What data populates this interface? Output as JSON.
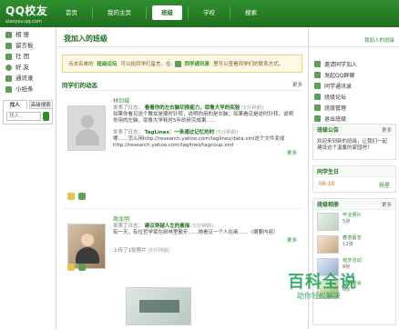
{
  "app": {
    "brand": "QQ校友",
    "domain": "xiaoyou.qq.com"
  },
  "nav": {
    "items": [
      "首页",
      "我的主页",
      "班级",
      "学校",
      "搜索"
    ],
    "active": "班级"
  },
  "left": {
    "items": [
      {
        "label": "相 册",
        "icon": "photo-icon"
      },
      {
        "label": "留言板",
        "icon": "message-board-icon"
      },
      {
        "label": "社 团",
        "icon": "club-icon"
      },
      {
        "label": "好 友",
        "icon": "friends-icon"
      },
      {
        "label": "通讯录",
        "icon": "address-book-icon"
      },
      {
        "label": "小纸条",
        "icon": "note-icon"
      }
    ],
    "search": {
      "tabs": [
        "找人",
        "高级搜索"
      ],
      "placeholder": "找人..."
    }
  },
  "main": {
    "header_title": "我加入的班级",
    "notice": {
      "prefix": "点击名单的",
      "link": "班级论坛",
      "middle": "可以给同学们留言，在",
      "link2": "同学通讯录",
      "suffix": "里可以查看同学们的联系方式。"
    },
    "feed_title": "同学们的动态",
    "feed_more": "更多",
    "feed": [
      {
        "user": "林剑城",
        "posts": [
          {
            "meta": "发表了日志：",
            "title": "看看你的左右脑切换能力，耶鲁大学的实验",
            "time": "(5分钟前)",
            "text": "如果你看见这个舞女是顺时针转，说明你用的是右脑；如果看见是逆时针转，说明你用的左脑，耶鲁大学耗时5年的研究成果……"
          },
          {
            "meta": "发表了日志：",
            "title": "TagLines：一条通过记忆的时",
            "time": "(5分钟前)",
            "text": "哪……怎么用http://research.yahoo.com/taglines/data.xml这个文件变成http://research.yahoo.com/taglines/tagcoup.xml"
          }
        ],
        "more": "更多"
      },
      {
        "user": "周龙明",
        "posts": [
          {
            "meta": "发表了日志：",
            "title": "建议穿越人生的素描",
            "time": "(5分钟前)",
            "text": "有一天，有位哲学家在树林里散步……她看见一个人在画……（摘要内容）"
          },
          {
            "meta": "上传了1张照片",
            "title": "",
            "time": "(5分钟前)",
            "text": ""
          }
        ],
        "more": "更多"
      }
    ]
  },
  "right": {
    "top_link": "我加入的班级",
    "actions": [
      {
        "label": "邀请同学加入",
        "icon": "invite-icon"
      },
      {
        "label": "发起QQ群聊",
        "icon": "qq-chat-icon"
      },
      {
        "label": "同学通讯录",
        "icon": "contacts-icon"
      },
      {
        "label": "班级论坛",
        "icon": "forum-icon"
      },
      {
        "label": "班级管理",
        "icon": "manage-icon"
      },
      {
        "label": "退出班级",
        "icon": "exit-icon"
      }
    ],
    "announcement": {
      "title": "班级公告",
      "more": "更多",
      "text": "欢迎来到新的班级，让我们一起建设这个温馨的家园吧！"
    },
    "birthday": {
      "title": "同学生日",
      "date": "06-10",
      "name": "杨星"
    },
    "album": {
      "title": "班级相册",
      "more": "更多",
      "items": [
        {
          "title": "毕业照片",
          "sub": "5张"
        },
        {
          "title": "春游留念",
          "sub": "12张"
        },
        {
          "title": "校庆活动",
          "sub": "8张"
        },
        {
          "title": "同学聚会",
          "sub": "6张"
        }
      ]
    }
  },
  "watermark": {
    "main": "百科全说",
    "sub": "助你轻松解决"
  },
  "colors": {
    "brand_green": "#1f6f1f",
    "accent_green": "#2f8f2f",
    "notice_bg": "#fff8e4"
  }
}
